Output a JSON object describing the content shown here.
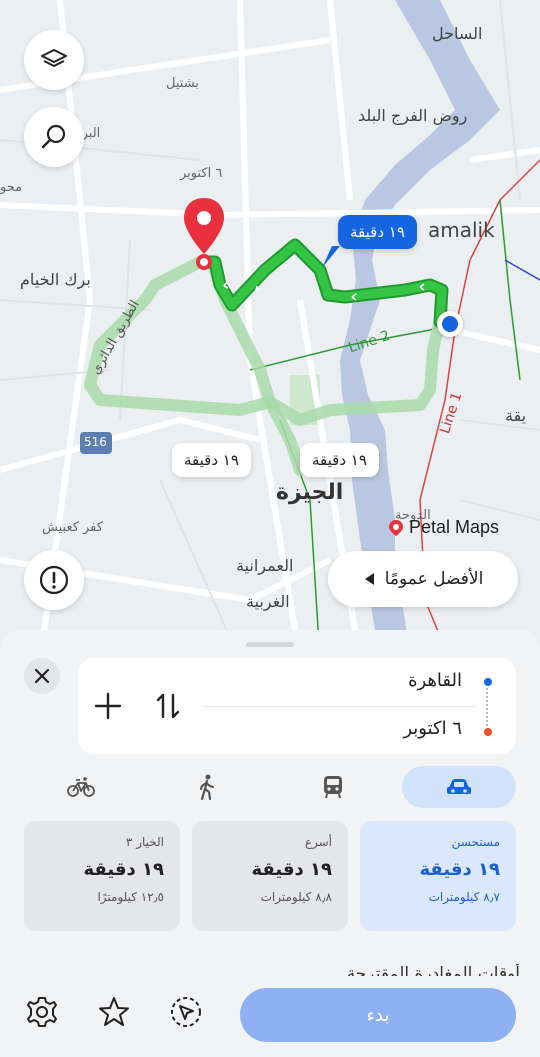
{
  "map": {
    "labels": {
      "el_sahel": "الساحل",
      "shubra": "بشتيل",
      "rod_el_farag": "روض الفرج البلد",
      "el_bara": "البرا",
      "oct6_street": "٦ اكتوبر",
      "zamalek": "amalik",
      "birk_el_khayam": "برك الخيام",
      "ring_road": "الطريق الدائري",
      "line2": "Line 2",
      "line1": "Line 1",
      "giza": "الجيزة",
      "kafr_kabish": "كفر كعبيش",
      "omraniya": "العمرانية",
      "gharbiya": "الغربية",
      "wiqa": "يقة",
      "dawa": "الدوحة",
      "mehwar": "محو",
      "road_516": "516"
    },
    "bubbles": {
      "main_route": "١٩ دقيقة",
      "alt_left": "١٩ دقيقة",
      "alt_right": "١٩ دقيقة"
    },
    "best_overall": "الأفضل عمومًا",
    "brand": "Petal Maps"
  },
  "route": {
    "from": "القاهرة",
    "to": "٦ اكتوبر"
  },
  "modes": [
    {
      "name": "drive",
      "icon": "car-icon",
      "active": true
    },
    {
      "name": "transit",
      "icon": "bus-icon",
      "active": false
    },
    {
      "name": "walk",
      "icon": "walk-icon",
      "active": false
    },
    {
      "name": "bike",
      "icon": "bike-icon",
      "active": false
    }
  ],
  "options": [
    {
      "label": "مستحسن",
      "time": "١٩ دقيقة",
      "distance": "٨٫٧ كيلومترات"
    },
    {
      "label": "أسرع",
      "time": "١٩ دقيقة",
      "distance": "٨٫٨ كيلومترات"
    },
    {
      "label": "الخيار ٣",
      "time": "١٩ دقيقة",
      "distance": "١٢٫٥ كيلومترًا"
    }
  ],
  "peek_text": "أوقات المغادرة المقترحة",
  "start_label": "بدء",
  "colors": {
    "route_green": "#2fbf3f",
    "alt_route": "#9fd6a2",
    "accent_blue": "#1565e0",
    "river": "#b9c7e2",
    "destination_red": "#e9303e"
  }
}
